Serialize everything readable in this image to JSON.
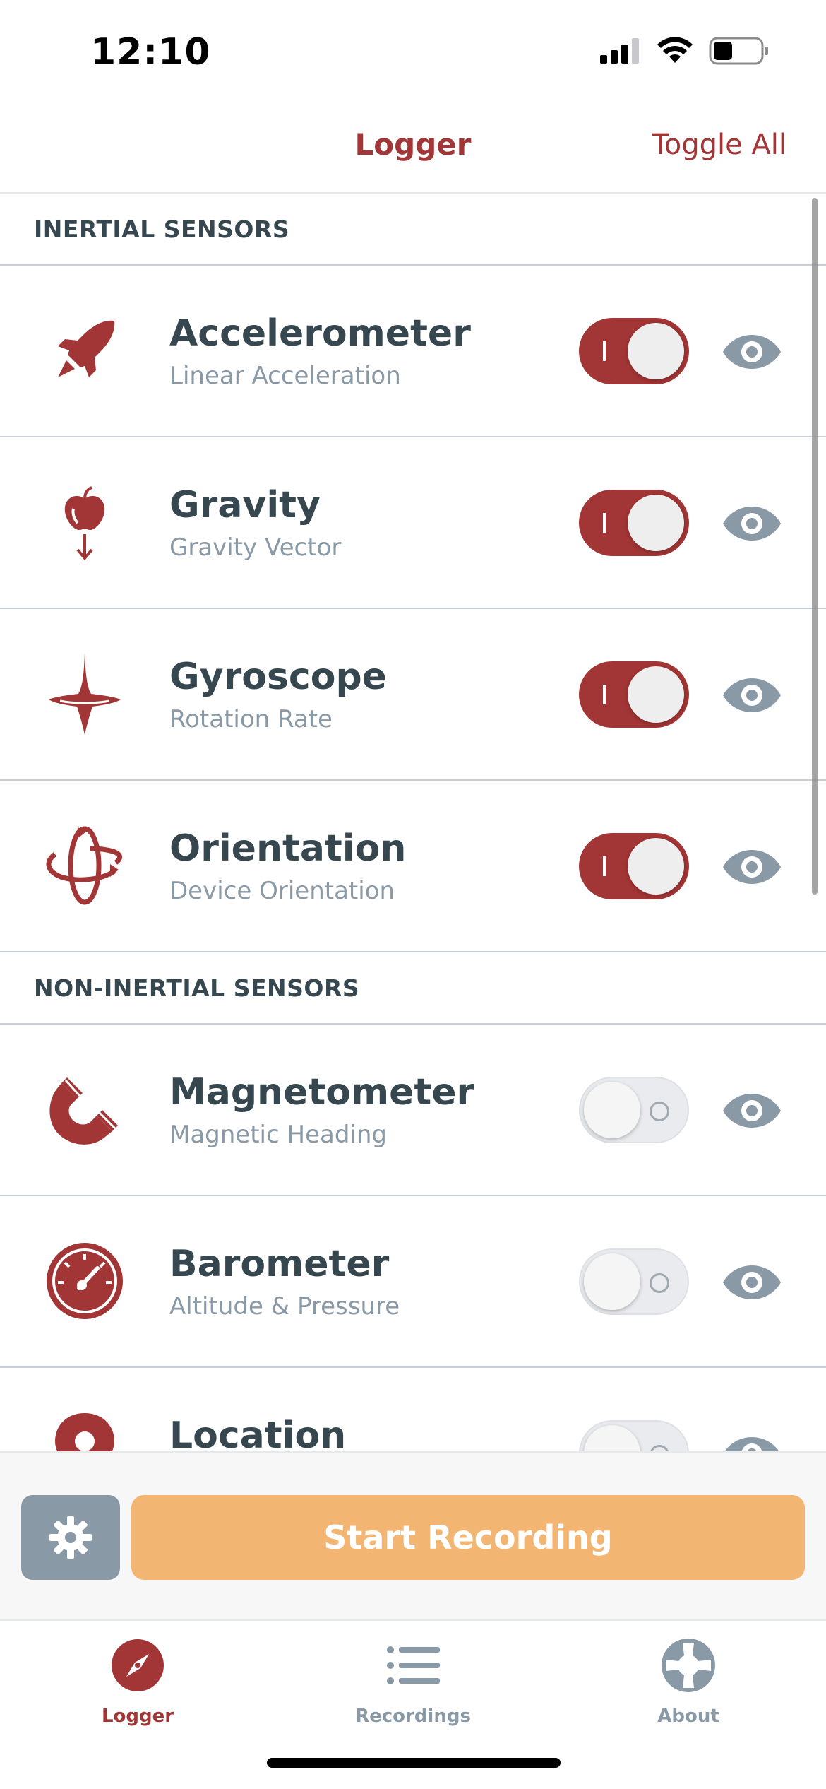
{
  "status_bar": {
    "time": "12:10"
  },
  "nav": {
    "title": "Logger",
    "action": "Toggle All"
  },
  "sections": [
    {
      "header": "INERTIAL SENSORS",
      "rows": [
        {
          "title": "Accelerometer",
          "subtitle": "Linear Acceleration",
          "icon": "rocket-icon",
          "enabled": true
        },
        {
          "title": "Gravity",
          "subtitle": "Gravity Vector",
          "icon": "apple-icon",
          "enabled": true
        },
        {
          "title": "Gyroscope",
          "subtitle": "Rotation Rate",
          "icon": "spinning-top-icon",
          "enabled": true
        },
        {
          "title": "Orientation",
          "subtitle": "Device Orientation",
          "icon": "orientation-icon",
          "enabled": true
        }
      ]
    },
    {
      "header": "NON-INERTIAL SENSORS",
      "rows": [
        {
          "title": "Magnetometer",
          "subtitle": "Magnetic Heading",
          "icon": "magnet-icon",
          "enabled": false
        },
        {
          "title": "Barometer",
          "subtitle": "Altitude & Pressure",
          "icon": "gauge-icon",
          "enabled": false
        },
        {
          "title": "Location",
          "subtitle": "",
          "icon": "location-pin-icon",
          "enabled": false
        }
      ]
    }
  ],
  "action_bar": {
    "record_label": "Start Recording"
  },
  "tabs": [
    {
      "label": "Logger",
      "icon": "compass-icon",
      "active": true
    },
    {
      "label": "Recordings",
      "icon": "list-icon",
      "active": false
    },
    {
      "label": "About",
      "icon": "lifebuoy-icon",
      "active": false
    }
  ],
  "colors": {
    "accent": "#a23535",
    "record_button": "#f2b572",
    "muted": "#8a99a6",
    "text": "#37474f"
  }
}
